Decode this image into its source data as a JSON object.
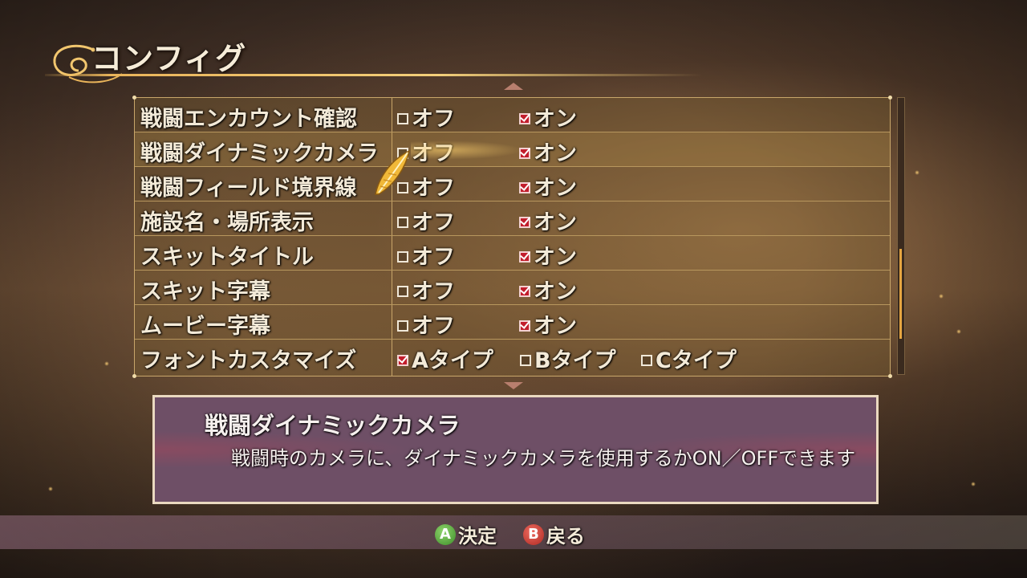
{
  "page": {
    "title": "コンフィグ"
  },
  "settings": [
    {
      "label": "戦闘エンカウント確認",
      "options": [
        {
          "text": "オフ",
          "checked": false
        },
        {
          "text": "オン",
          "checked": true
        }
      ]
    },
    {
      "label": "戦闘ダイナミックカメラ",
      "selected": true,
      "options": [
        {
          "text": "オフ",
          "checked": false
        },
        {
          "text": "オン",
          "checked": true
        }
      ]
    },
    {
      "label": "戦闘フィールド境界線",
      "options": [
        {
          "text": "オフ",
          "checked": false
        },
        {
          "text": "オン",
          "checked": true
        }
      ]
    },
    {
      "label": "施設名・場所表示",
      "options": [
        {
          "text": "オフ",
          "checked": false
        },
        {
          "text": "オン",
          "checked": true
        }
      ]
    },
    {
      "label": "スキットタイトル",
      "options": [
        {
          "text": "オフ",
          "checked": false
        },
        {
          "text": "オン",
          "checked": true
        }
      ]
    },
    {
      "label": "スキット字幕",
      "options": [
        {
          "text": "オフ",
          "checked": false
        },
        {
          "text": "オン",
          "checked": true
        }
      ]
    },
    {
      "label": "ムービー字幕",
      "options": [
        {
          "text": "オフ",
          "checked": false
        },
        {
          "text": "オン",
          "checked": true
        }
      ]
    },
    {
      "label": "フォントカスタマイズ",
      "options": [
        {
          "text": "Aタイプ",
          "checked": true
        },
        {
          "text": "Bタイプ",
          "checked": false
        },
        {
          "text": "Cタイプ",
          "checked": false
        }
      ]
    }
  ],
  "description": {
    "title": "戦闘ダイナミックカメラ",
    "text": "戦闘時のカメラに、ダイナミックカメラを使用するかON／OFFできます"
  },
  "footer": {
    "confirm": {
      "button": "A",
      "label": "決定"
    },
    "back": {
      "button": "B",
      "label": "戻る"
    }
  },
  "colors": {
    "check": "#c21d2c",
    "accent": "#e9b45a",
    "scrollbar": "#e6a640"
  },
  "icons": {
    "cursor": "feather-cursor-icon",
    "ornament": "title-ornament-icon"
  }
}
